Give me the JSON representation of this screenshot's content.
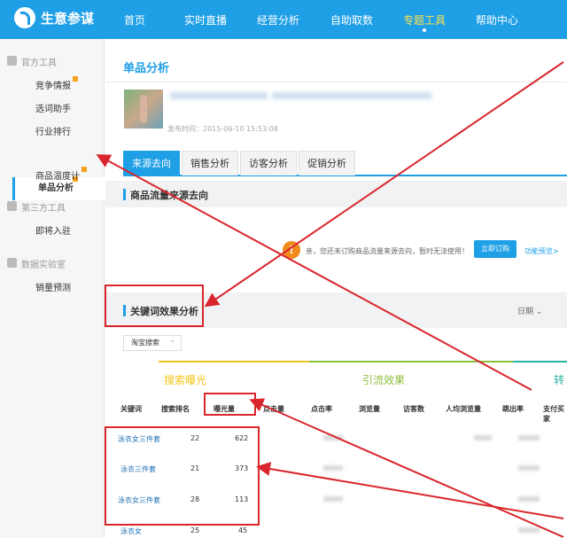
{
  "topbar": {
    "brand": "生意参谋",
    "nav": [
      "首页",
      "实时直播",
      "经营分析",
      "自助取数",
      "专题工具",
      "帮助中心"
    ],
    "active_nav": "专题工具"
  },
  "sidebar": {
    "sections": [
      {
        "title": "官方工具",
        "items": [
          "竞争情报",
          "选词助手",
          "行业排行",
          "单品分析",
          "商品温度计"
        ]
      },
      {
        "title": "第三方工具",
        "items": [
          "即将入驻"
        ]
      },
      {
        "title": "数据实验室",
        "items": [
          "销量预测"
        ]
      }
    ],
    "active_item": "单品分析"
  },
  "page": {
    "title": "单品分析",
    "publish_time": "发布时间：2015-06-10 15:53:08"
  },
  "tabs": [
    "来源去向",
    "销售分析",
    "访客分析",
    "促销分析"
  ],
  "source_section": {
    "title": "商品流量来源去向",
    "notice": "亲，您还未订购商品流量来源去向，暂时无法使用！",
    "buy_button": "立即订购",
    "preview_link": "功能预览>"
  },
  "keyword_section": {
    "title": "关键词效果分析",
    "date_label": "日期",
    "source_dropdown": "淘宝搜索",
    "groups": [
      "搜索曝光",
      "引流效果",
      "转"
    ],
    "columns": [
      "关键词",
      "搜索排名",
      "曝光量",
      "点击量",
      "点击率",
      "浏览量",
      "访客数",
      "人均浏览量",
      "跳出率",
      "支付买家"
    ],
    "rows": [
      {
        "keyword": "泳衣女三件套",
        "rank": "22",
        "exposure": "622"
      },
      {
        "keyword": "泳衣三件套",
        "rank": "21",
        "exposure": "373"
      },
      {
        "keyword": "泳衣女三件套",
        "rank": "28",
        "exposure": "113"
      },
      {
        "keyword": "泳衣女",
        "rank": "25",
        "exposure": "45"
      }
    ]
  },
  "colors": {
    "brand_blue": "#1f9fe6",
    "annotation_red": "#d9262c",
    "warning_orange": "#f08c1c",
    "group_exposure": "#f5c518",
    "group_traffic": "#8dbf3f"
  }
}
